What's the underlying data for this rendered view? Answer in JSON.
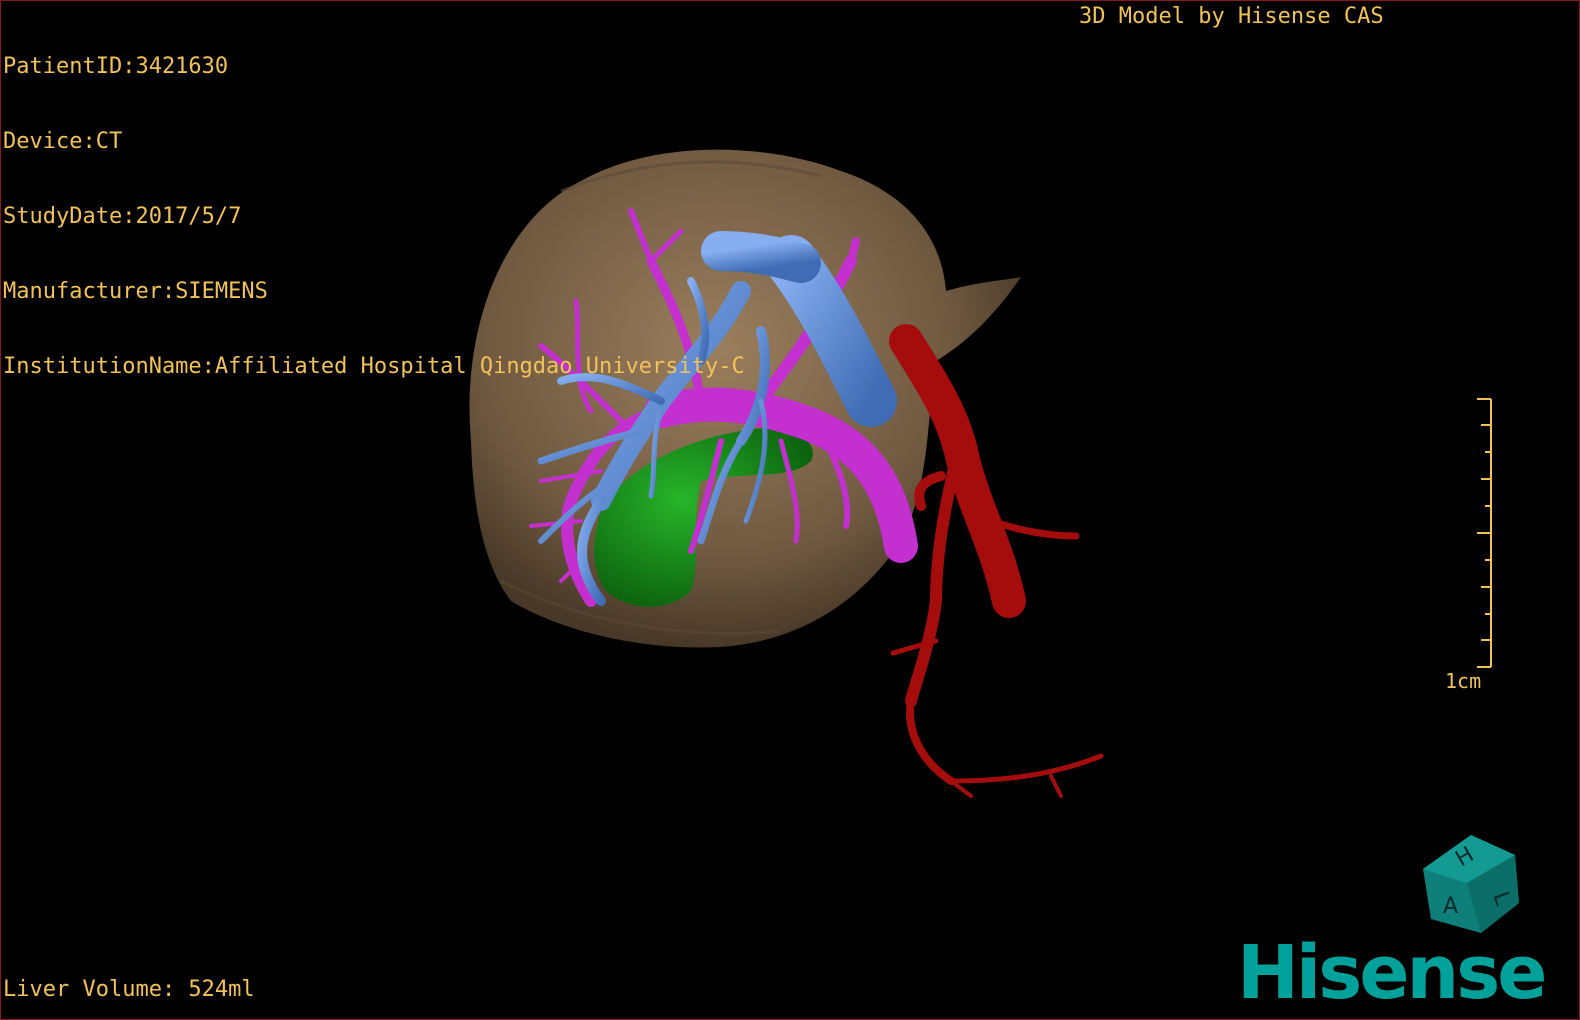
{
  "patient_info": {
    "patient_id": "PatientID:3421630",
    "device": "Device:CT",
    "study_date": "StudyDate:2017/5/7",
    "manufacturer": "Manufacturer:SIEMENS",
    "institution": "InstitutionName:Affiliated Hospital Qingdao University-C"
  },
  "credit": "3D Model by Hisense CAS",
  "scale_bar": {
    "label": "1cm"
  },
  "measurements": {
    "liver_volume": "Liver Volume: 524ml"
  },
  "orientation_cube": {
    "face_top": "H",
    "face_side": "L",
    "face_front": "A"
  },
  "brand": "Hisense",
  "colors": {
    "overlay_text": "#f2c25a",
    "liver": "#8b6f4e",
    "portal_vein": "#c42fd0",
    "hepatic_vein": "#5f8fd4",
    "gallbladder": "#0f8a12",
    "hepatic_artery": "#a50d0d",
    "brand": "#00a19a"
  }
}
